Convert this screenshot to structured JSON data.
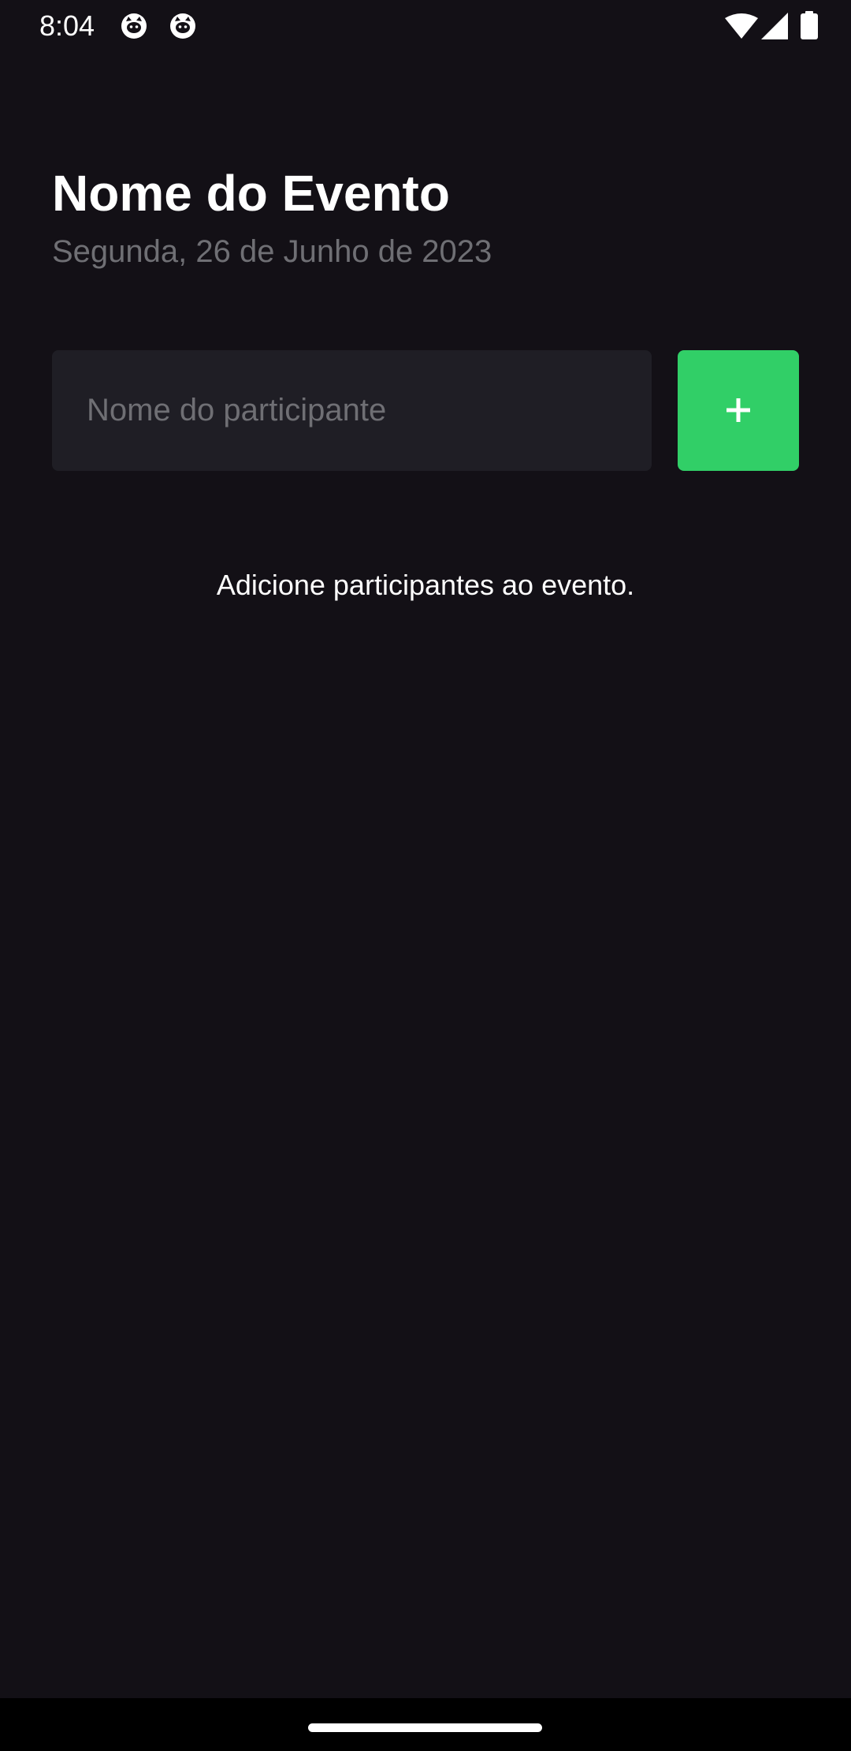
{
  "status_bar": {
    "time": "8:04",
    "notification_icons": [
      "cat-face-icon",
      "cat-face-icon"
    ],
    "system_icons": [
      "wifi-icon",
      "cellular-signal-icon",
      "battery-icon"
    ]
  },
  "event": {
    "title": "Nome do Evento",
    "date": "Segunda, 26 de Junho de 2023"
  },
  "participant_form": {
    "input_placeholder": "Nome do participante",
    "input_value": "",
    "add_button_icon": "plus-icon"
  },
  "participants": [],
  "empty_state": {
    "message": "Adicione participantes ao evento."
  },
  "colors": {
    "background": "#131016",
    "input_background": "#1f1e25",
    "accent": "#31cf67",
    "muted_text": "#6f6f74",
    "text": "#ffffff"
  }
}
